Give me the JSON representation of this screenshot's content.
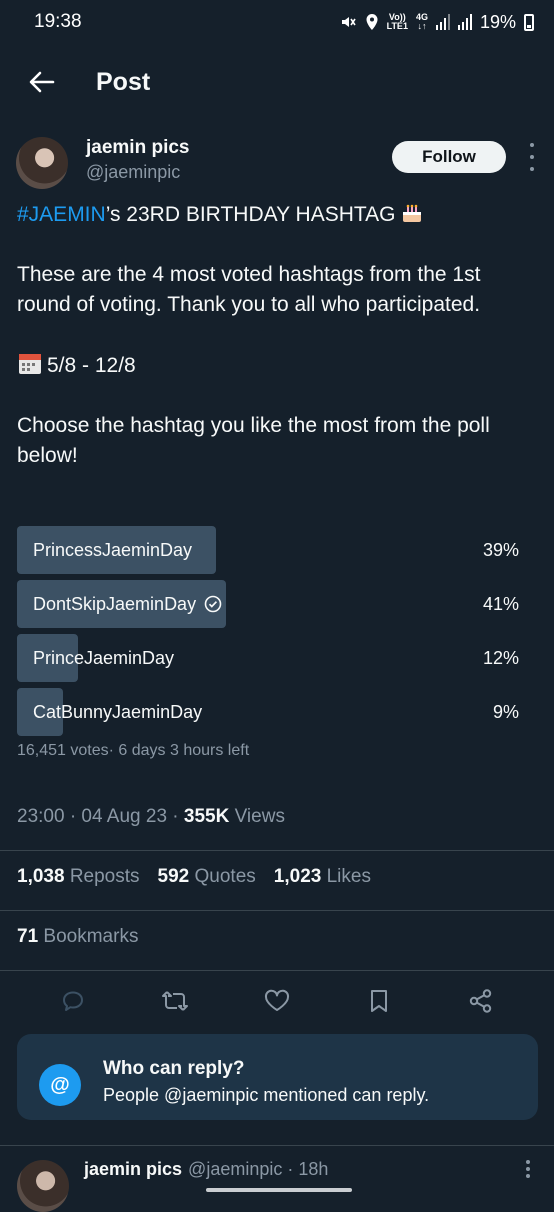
{
  "status_bar": {
    "time": "19:38",
    "battery": "19%",
    "network_top": "Vo))",
    "network_bottom": "LTE1",
    "gen": "4G"
  },
  "header": {
    "title": "Post"
  },
  "author": {
    "name": "jaemin pics",
    "handle": "@jaeminpic",
    "follow_label": "Follow"
  },
  "tweet": {
    "hashtag": "#JAEMIN",
    "line1_rest": "’s 23RD BIRTHDAY HASHTAG",
    "para2": "These are the 4 most voted hashtags from the 1st round of voting. Thank you to all who participated.",
    "dates": "5/8 - 12/8",
    "para4": "Choose the hashtag you like the most from the poll below!"
  },
  "poll": {
    "options": [
      {
        "label": "PrincessJaeminDay",
        "percent": "39%",
        "value": 39,
        "selected": false
      },
      {
        "label": "DontSkipJaeminDay",
        "percent": "41%",
        "value": 41,
        "selected": true
      },
      {
        "label": "PrinceJaeminDay",
        "percent": "12%",
        "value": 12,
        "selected": false
      },
      {
        "label": "CatBunnyJaeminDay",
        "percent": "9%",
        "value": 9,
        "selected": false
      }
    ],
    "meta": "16,451 votes· 6 days 3 hours left"
  },
  "timestamp": {
    "time_date": "23:00 · 04 Aug 23 · ",
    "views_count": "355K",
    "views_label": " Views"
  },
  "stats": {
    "reposts_count": "1,038",
    "reposts_label": "Reposts",
    "quotes_count": "592",
    "quotes_label": "Quotes",
    "likes_count": "1,023",
    "likes_label": "Likes",
    "bookmarks_count": "71",
    "bookmarks_label": "Bookmarks"
  },
  "reply_restriction": {
    "title": "Who can reply?",
    "subtitle": "People @jaeminpic mentioned can reply.",
    "icon_text": "@"
  },
  "next_tweet": {
    "name": "jaemin pics",
    "handle_time": "@jaeminpic · 18h"
  },
  "colors": {
    "background": "#15202b",
    "accent": "#1d9bf0",
    "poll_bar": "#3c5164",
    "muted": "#8b98a5"
  }
}
